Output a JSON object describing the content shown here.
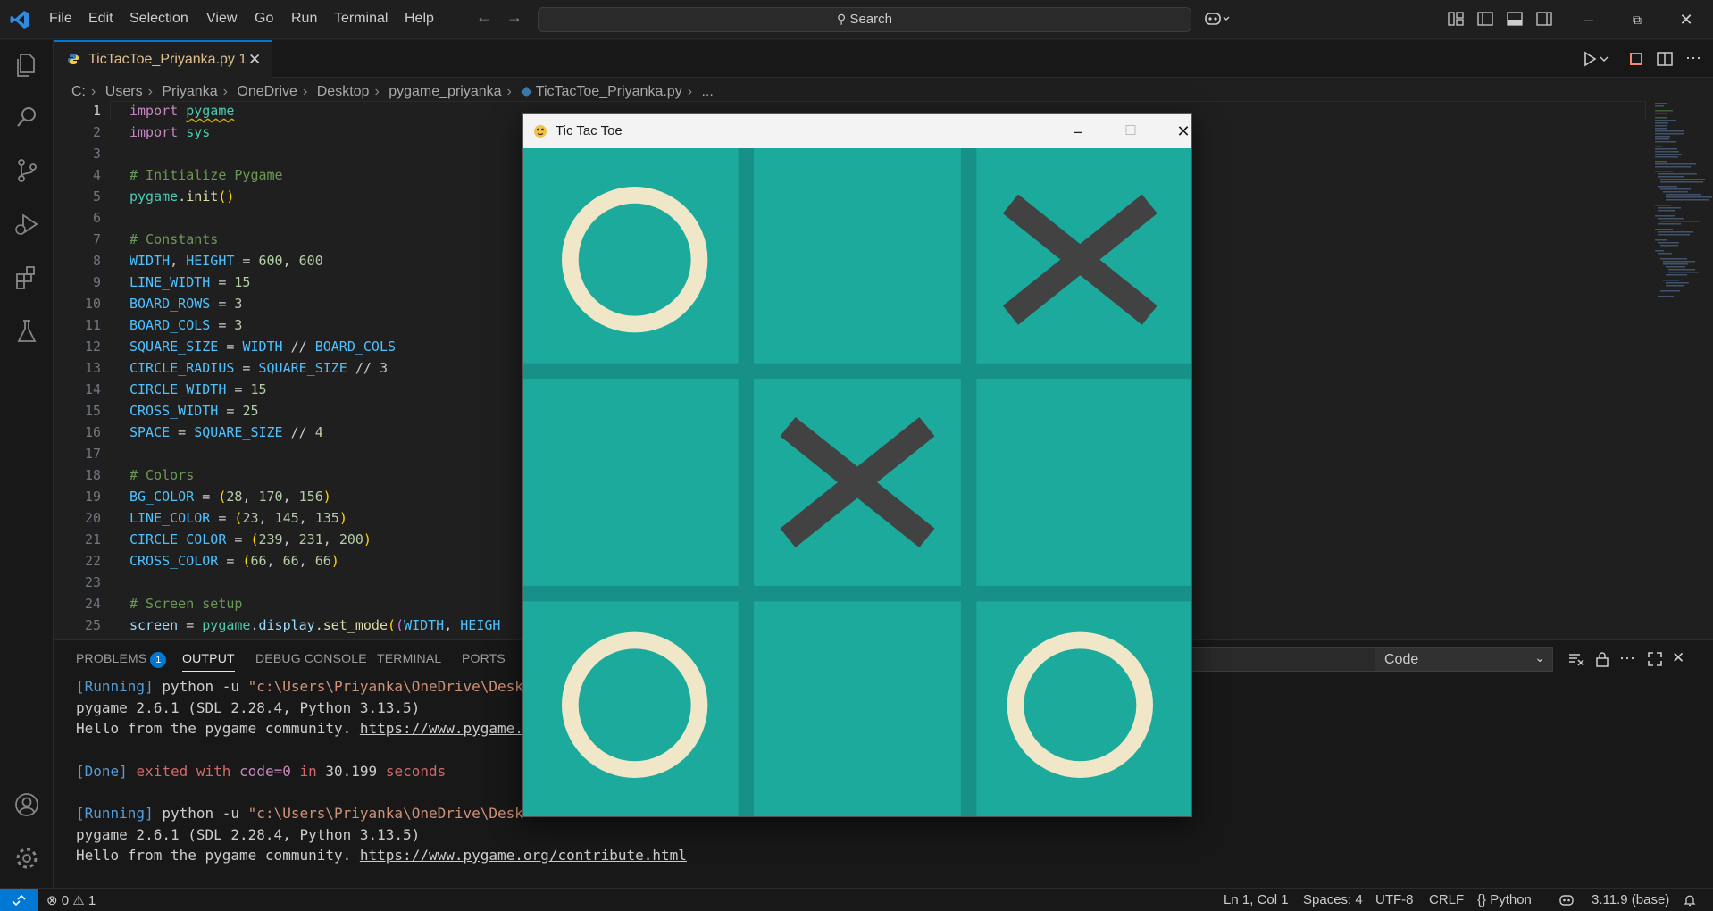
{
  "menubar": {
    "items": [
      "File",
      "Edit",
      "Selection",
      "View",
      "Go",
      "Run",
      "Terminal",
      "Help"
    ],
    "search_placeholder": "Search"
  },
  "activity_bar": {
    "icons": [
      "files-icon",
      "search-icon",
      "source-control-icon",
      "run-debug-icon",
      "extensions-icon",
      "testing-icon",
      "account-icon",
      "settings-gear-icon"
    ]
  },
  "tab": {
    "filename": "TicTacToe_Priyanka.py",
    "problems": "1"
  },
  "breadcrumb": [
    "C:",
    "Users",
    "Priyanka",
    "OneDrive",
    "Desktop",
    "pygame_priyanka",
    "TicTacToe_Priyanka.py",
    "..."
  ],
  "editor": {
    "line_numbers": [
      "1",
      "2",
      "3",
      "4",
      "5",
      "6",
      "7",
      "8",
      "9",
      "10",
      "11",
      "12",
      "13",
      "14",
      "15",
      "16",
      "17",
      "18",
      "19",
      "20",
      "21",
      "22",
      "23",
      "24",
      "25"
    ],
    "lines": [
      "import pygame",
      "import sys",
      "",
      "# Initialize Pygame",
      "pygame.init()",
      "",
      "# Constants",
      "WIDTH, HEIGHT = 600, 600",
      "LINE_WIDTH = 15",
      "BOARD_ROWS = 3",
      "BOARD_COLS = 3",
      "SQUARE_SIZE = WIDTH // BOARD_COLS",
      "CIRCLE_RADIUS = SQUARE_SIZE // 3",
      "CIRCLE_WIDTH = 15",
      "CROSS_WIDTH = 25",
      "SPACE = SQUARE_SIZE // 4",
      "",
      "# Colors",
      "BG_COLOR = (28, 170, 156)",
      "LINE_COLOR = (23, 145, 135)",
      "CIRCLE_COLOR = (239, 231, 200)",
      "CROSS_COLOR = (66, 66, 66)",
      "",
      "# Screen setup",
      "screen = pygame.display.set_mode((WIDTH, HEIGH"
    ]
  },
  "panel": {
    "tabs": [
      "PROBLEMS",
      "OUTPUT",
      "DEBUG CONSOLE",
      "TERMINAL",
      "PORTS"
    ],
    "problems_count": "1",
    "active_tab": "OUTPUT",
    "output_channel": "Code",
    "output_lines": [
      "[Running] python -u \"c:\\Users\\Priyanka\\OneDrive\\Desk",
      "pygame 2.6.1 (SDL 2.28.4, Python 3.13.5)",
      "Hello from the pygame community. https://www.pygame.",
      "",
      "[Done] exited with code=0 in 30.199 seconds",
      "",
      "[Running] python -u \"c:\\Users\\Priyanka\\OneDrive\\Desk",
      "pygame 2.6.1 (SDL 2.28.4, Python 3.13.5)",
      "Hello from the pygame community. https://www.pygame.org/contribute.html"
    ]
  },
  "statusbar": {
    "errors": "0",
    "warnings": "1",
    "position": "Ln 1, Col 1",
    "spaces": "Spaces: 4",
    "encoding": "UTF-8",
    "eol": "CRLF",
    "language": "Python",
    "interpreter": "3.11.9 (base)"
  },
  "game_window": {
    "title": "Tic Tac Toe",
    "board": [
      [
        "O",
        "",
        "X"
      ],
      [
        "",
        "X",
        ""
      ],
      [
        "O",
        "",
        "O"
      ]
    ],
    "colors": {
      "bg": "#1caa9c",
      "line": "#179187",
      "circle": "#efe7c8",
      "cross": "#424242"
    }
  },
  "colors": {
    "accent": "#0078d4",
    "editor_bg": "#1f1f1f",
    "tab_modified": "#e2c08d"
  }
}
